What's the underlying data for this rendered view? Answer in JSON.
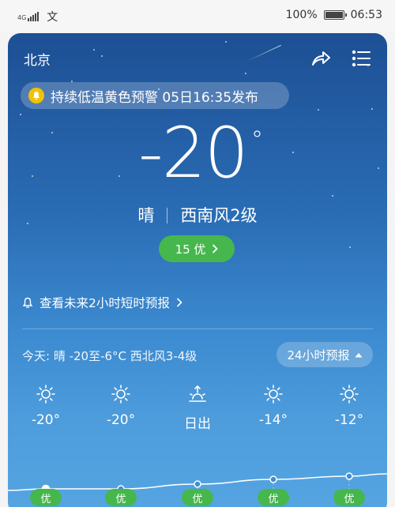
{
  "status_bar": {
    "network": "4G",
    "carrier_glyph": "文",
    "battery": "100%",
    "battery_level": 1.0,
    "time": "06:53"
  },
  "header": {
    "city": "北京",
    "share_icon": "share-arrow-icon",
    "menu_icon": "menu-list-icon"
  },
  "warning": {
    "icon": "bell-icon",
    "text": "持续低温黄色预警 05日16:35发布"
  },
  "current": {
    "temperature": "-20",
    "degree": "°",
    "condition": "晴",
    "wind": "西南风2级"
  },
  "aqi": {
    "label": "15 优",
    "color": "#46b74d"
  },
  "forecast_link": {
    "text": "查看未来2小时短时预报"
  },
  "today": {
    "summary": "今天:  晴  -20至-6°C  西北风3-4级",
    "button_label": "24小时预报"
  },
  "hourly": [
    {
      "icon": "sun-icon",
      "label": "-20°",
      "temp": -20,
      "aqi": "优"
    },
    {
      "icon": "sun-icon",
      "label": "-20°",
      "temp": -20,
      "aqi": "优"
    },
    {
      "icon": "sunrise-icon",
      "label": "日出",
      "temp": -17,
      "aqi": "优"
    },
    {
      "icon": "sun-icon",
      "label": "-14°",
      "temp": -14,
      "aqi": "优"
    },
    {
      "icon": "sun-icon",
      "label": "-12°",
      "temp": -12,
      "aqi": "优"
    }
  ]
}
